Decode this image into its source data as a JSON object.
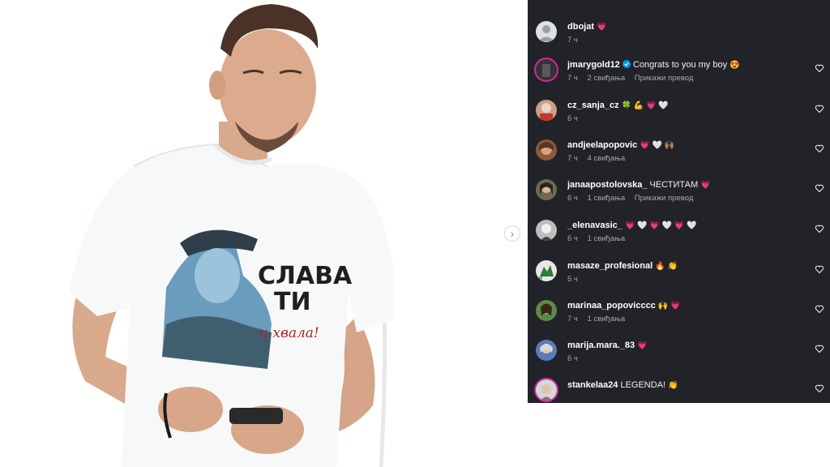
{
  "post": {
    "tshirt": {
      "line1": "СЛАВА",
      "line2": "ТИ",
      "line3": "и хвала!"
    }
  },
  "carousel": {
    "next_icon": "chevron-right-icon",
    "next_glyph": "›"
  },
  "comments": [
    {
      "username": "dbojat",
      "text": "",
      "emoji": "💗",
      "time": "7 ч",
      "likes": "",
      "translate": ""
    },
    {
      "username": "jmarygold12",
      "verified": true,
      "text": "Congrats to you my boy",
      "emoji": "😍",
      "time": "7 ч",
      "likes": "2 свиђања",
      "translate": "Прикажи превод"
    },
    {
      "username": "cz_sanja_cz",
      "text": "",
      "emoji": "🍀 💪 💗 🤍",
      "time": "6 ч",
      "likes": "",
      "translate": ""
    },
    {
      "username": "andjeelapopovic",
      "text": "",
      "emoji": "💗 🤍 🙌🏽",
      "time": "7 ч",
      "likes": "4 свиђања",
      "translate": ""
    },
    {
      "username": "janaapostolovska_",
      "text": "ЧЕСТИТАМ",
      "emoji": "💗",
      "time": "6 ч",
      "likes": "1 свиђања",
      "translate": "Прикажи превод"
    },
    {
      "username": "_elenavasic_",
      "text": "",
      "emoji": "💗 🤍 💗 🤍 💗 🤍",
      "time": "6 ч",
      "likes": "1 свиђања",
      "translate": ""
    },
    {
      "username": "masaze_profesional",
      "text": "",
      "emoji": "🔥 👏",
      "time": "5 ч",
      "likes": "",
      "translate": ""
    },
    {
      "username": "marinaa_popovicccc",
      "text": "",
      "emoji": "🙌 💗",
      "time": "7 ч",
      "likes": "1 свиђања",
      "translate": ""
    },
    {
      "username": "marija.mara._83",
      "text": "",
      "emoji": "💗",
      "time": "6 ч",
      "likes": "",
      "translate": ""
    },
    {
      "username": "stankelaa24",
      "text": "LEGENDA!",
      "emoji": "👏",
      "time": "",
      "likes": "",
      "translate": ""
    }
  ],
  "colors": {
    "panel_bg": "#212328",
    "meta_text": "#a8a8a8",
    "heart": "#ff3b6b",
    "verified": "#0095f6",
    "story_ring": "#d6249f"
  }
}
